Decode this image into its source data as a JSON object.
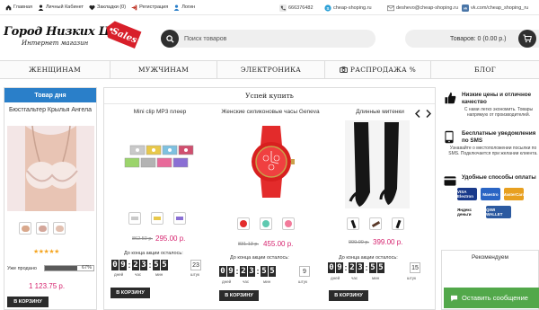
{
  "topbar": {
    "home": "Главная",
    "account": "Личный Кабинет",
    "wishlist": "Закладки (0)",
    "register": "Регистрация",
    "login": "Логин",
    "phone": "666376482",
    "skype": "cheap-shoping.ru",
    "email": "deshevo@cheap-shoping.ru",
    "vk": "vk.com/cheap_shoping_ru"
  },
  "header": {
    "logo_title": "Город Низких Цен",
    "logo_subtitle": "Интернет магазин",
    "sales_tag": "Sales",
    "search_placeholder": "Поиск товаров",
    "cart_label": "Товаров: 0 (0.00 р.)"
  },
  "nav": [
    "ЖЕНЩИНАМ",
    "МУЖЧИНАМ",
    "ЭЛЕКТРОНИКА",
    "РАСПРОДАЖА %",
    "БЛОГ"
  ],
  "day_product": {
    "heading": "Товар дня",
    "title": "Бюстгальтер Крылья Ангела",
    "stars": "★★★★★",
    "sold_label": "Уже продано",
    "sold_percent": 67,
    "sold_percent_text": "67%",
    "price": "1 123.75 р.",
    "cart_button": "В КОРЗИНУ"
  },
  "hurry": {
    "heading": "Успей купить",
    "until_label": "До конца акции осталось:",
    "time_labels": [
      "дней",
      "час",
      "мин",
      "штук"
    ],
    "buy_button": "В КОРЗИНУ",
    "products": [
      {
        "title": "Mini clip MP3 плеер",
        "old_price": "862.50 р.",
        "price": "295.00 р.",
        "timer": [
          "0",
          "9",
          ":",
          "2",
          "3",
          ":",
          "5",
          "5"
        ],
        "stock": "23"
      },
      {
        "title": "Женские силиконовые часы Geneva",
        "old_price": "831.13 р.",
        "price": "455.00 р.",
        "timer": [
          "0",
          "9",
          ":",
          "2",
          "3",
          ":",
          "5",
          "5"
        ],
        "stock": "9"
      },
      {
        "title": "Длинные митенки",
        "old_price": "900.00 р.",
        "price": "399.00 р.",
        "timer": [
          "0",
          "9",
          ":",
          "2",
          "3",
          ":",
          "5",
          "5"
        ],
        "stock": "15"
      }
    ]
  },
  "features": {
    "low_prices_title": "Низкие цены и отличное качество",
    "low_prices_text": "С нами легко экономить. Товары напрямую от производителей.",
    "sms_title": "Бесплатные уведомления по SMS",
    "sms_text": "Узнавайте о местоположении посылки по SMS. Подключается при желании клиента.",
    "pay_title": "Удобные способы оплаты",
    "pay_logos": [
      "VISA Electron",
      "Maestro",
      "MasterCard",
      "Яндекс деньги",
      "QIWI WALLET"
    ]
  },
  "recommend": {
    "heading": "Рекомендуем"
  },
  "chat": {
    "label": "Оставить сообщение"
  },
  "colors": {
    "accent_blue": "#2a7fc9",
    "price_pink": "#d6246f",
    "chat_green": "#52a84a"
  }
}
